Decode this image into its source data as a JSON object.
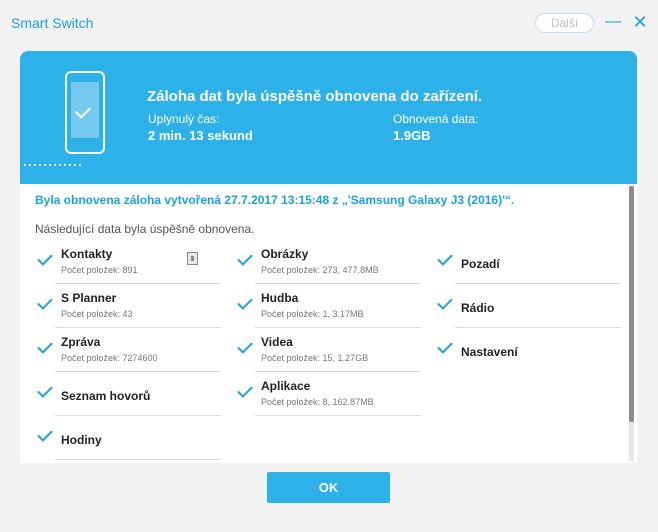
{
  "window": {
    "title": "Smart Switch",
    "next_label": "Další"
  },
  "header": {
    "title": "Záloha dat byla úspěšně obnovena do zařízení.",
    "elapsed_label": "Uplynulý čas:",
    "elapsed_value": "2 min. 13 sekund",
    "restored_label": "Obnovená data:",
    "restored_value": "1.9GB"
  },
  "content": {
    "backup_line": "Byla obnovena záloha vytvořená 27.7.2017 13:15:48 z „'Samsung Galaxy J3 (2016)'“.",
    "note": "Následující data byla úspěšně obnovena.",
    "items": [
      {
        "name": "Kontakty",
        "detail": "Počet položek: 891"
      },
      {
        "name": "S Planner",
        "detail": "Počet položek: 43"
      },
      {
        "name": "Zpráva",
        "detail": "Počet položek: 7274600"
      },
      {
        "name": "Seznam hovorů",
        "detail": ""
      },
      {
        "name": "Hodiny",
        "detail": ""
      },
      {
        "name": "Obrázky",
        "detail": "Počet položek: 273, 477.8MB"
      },
      {
        "name": "Hudba",
        "detail": "Počet položek: 1, 3.17MB"
      },
      {
        "name": "Videa",
        "detail": "Počet položek: 15, 1.27GB"
      },
      {
        "name": "Aplikace",
        "detail": "Počet položek: 8, 162.87MB"
      },
      {
        "name": "Pozadí",
        "detail": ""
      },
      {
        "name": "Rádio",
        "detail": ""
      },
      {
        "name": "Nastavení",
        "detail": ""
      }
    ]
  },
  "footer": {
    "ok_label": "OK"
  },
  "colors": {
    "accent": "#2db1e9",
    "link_blue": "#1aa1e5"
  }
}
